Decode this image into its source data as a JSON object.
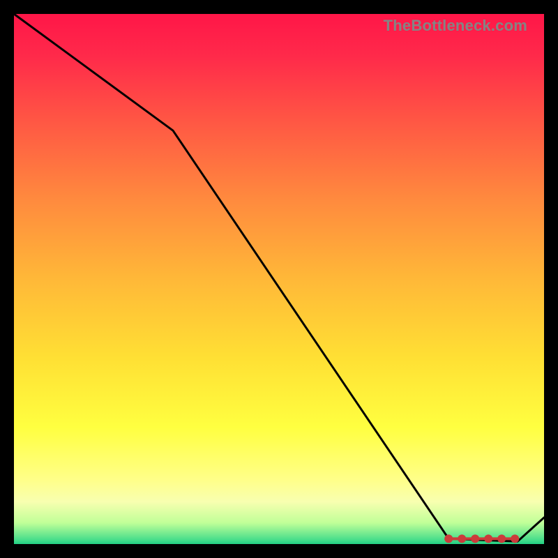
{
  "attribution": "TheBottleneck.com",
  "chart_data": {
    "type": "line",
    "title": "",
    "xlabel": "",
    "ylabel": "",
    "xlim": [
      0,
      100
    ],
    "ylim": [
      0,
      100
    ],
    "x": [
      0,
      30,
      82,
      95,
      100
    ],
    "series": [
      {
        "name": "curve",
        "values": [
          100,
          78,
          1,
          0.5,
          5
        ]
      }
    ],
    "markers": {
      "name": "optimal-range",
      "x_positions": [
        82,
        84.5,
        87,
        89.5,
        92,
        94.5
      ],
      "y": 1,
      "color": "#cc3b3b"
    },
    "background": "red-yellow-green-gradient"
  }
}
